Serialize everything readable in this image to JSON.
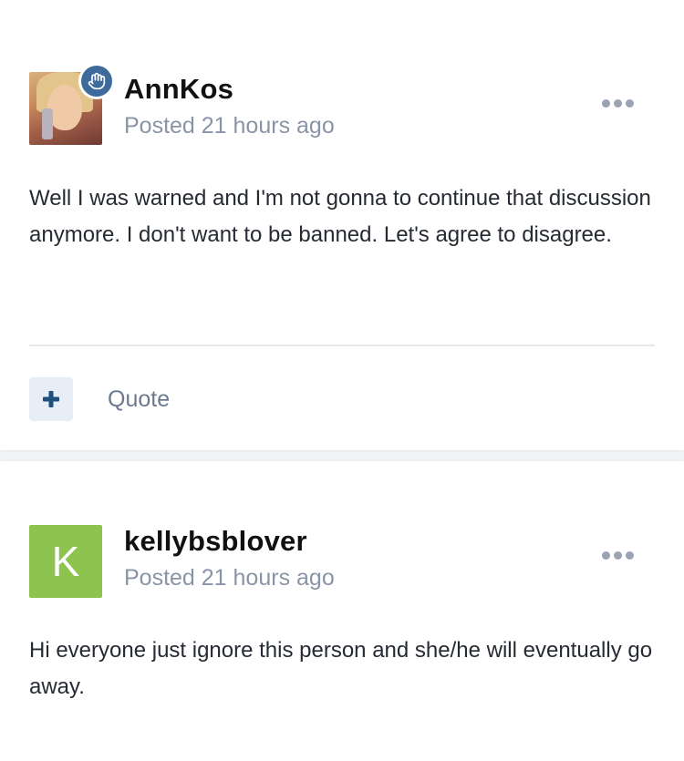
{
  "posts": [
    {
      "username": "AnnKos",
      "posted": "Posted 21 hours ago",
      "body": "Well I was warned and I'm not gonna to continue that discussion anymore. I don't want to be banned. Let's agree to disagree.",
      "avatar_type": "photo",
      "badge_icon": "hand-icon",
      "badge_color": "#3e6b9b",
      "quote_label": "Quote"
    },
    {
      "username": "kellybsblover",
      "posted": "Posted 21 hours ago",
      "body": "Hi everyone just ignore this person and she/he will eventually go away.",
      "avatar_letter": "K",
      "avatar_color": "#8ec350"
    }
  ],
  "colors": {
    "accent": "#3e6b9b",
    "muted_text": "#8a94a6",
    "divider": "#e6e8eb"
  }
}
